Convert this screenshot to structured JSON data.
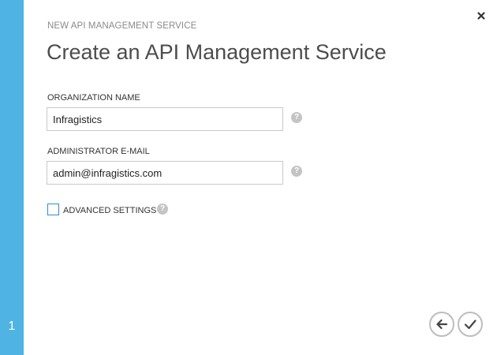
{
  "wizard": {
    "step_number": "1",
    "section_label": "NEW API MANAGEMENT SERVICE",
    "title": "Create an API Management Service"
  },
  "form": {
    "organization_name": {
      "label": "ORGANIZATION NAME",
      "value": "Infragistics",
      "help": "?"
    },
    "administrator_email": {
      "label": "ADMINISTRATOR E-MAIL",
      "value": "admin@infragistics.com",
      "help": "?"
    },
    "advanced_settings": {
      "label": "ADVANCED SETTINGS",
      "checked": false,
      "help": "?"
    }
  },
  "icons": {
    "close": "close-icon",
    "back": "arrow-left-icon",
    "complete": "checkmark-icon",
    "help": "question-mark-icon"
  },
  "colors": {
    "accent": "#4fb3e3",
    "checkbox_border": "#2e8fcc",
    "button_border": "#bdbdbd",
    "help_icon": "#c4c4c4"
  }
}
